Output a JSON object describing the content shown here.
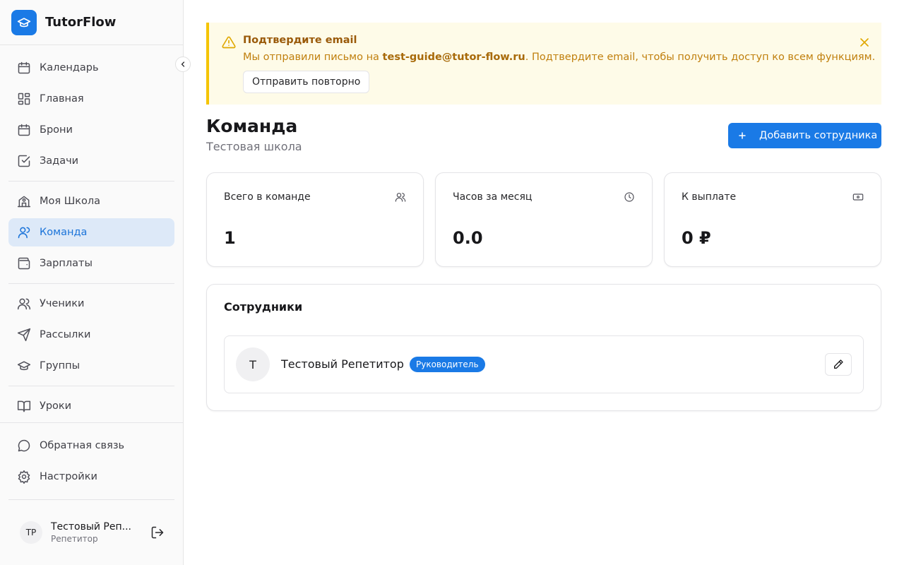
{
  "app": {
    "name": "TutorFlow",
    "logo_icon": "graduation-cap-icon",
    "accent": "#1a7ae6"
  },
  "sidebar": {
    "items": [
      {
        "label": "Календарь",
        "icon": "calendar-icon"
      },
      {
        "label": "Главная",
        "icon": "dashboard-icon"
      },
      {
        "label": "Брони",
        "icon": "calendar-icon"
      },
      {
        "label": "Задачи",
        "icon": "checkbox-icon"
      },
      {
        "label": "Моя Школа",
        "icon": "school-icon"
      },
      {
        "label": "Команда",
        "icon": "user-icon",
        "active": true
      },
      {
        "label": "Зарплаты",
        "icon": "wallet-icon"
      },
      {
        "label": "Ученики",
        "icon": "users-icon"
      },
      {
        "label": "Рассылки",
        "icon": "send-icon"
      },
      {
        "label": "Группы",
        "icon": "graduation-cap-icon"
      },
      {
        "label": "Уроки",
        "icon": "book-icon"
      },
      {
        "label": "Обратная связь",
        "icon": "message-icon"
      },
      {
        "label": "Настройки",
        "icon": "gear-icon"
      }
    ],
    "user": {
      "initials": "ТР",
      "name": "Тестовый Реп...",
      "role": "Репетитор"
    }
  },
  "alert": {
    "title": "Подтвердите email",
    "text_before": "Мы отправили письмо на ",
    "email": "test-guide@tutor-flow.ru",
    "text_after": ". Подтвердите email, чтобы получить доступ ко всем функциям.",
    "button": "Отправить повторно",
    "bg": "#fefbe8",
    "border": "#f5c400"
  },
  "header": {
    "title": "Команда",
    "subtitle": "Тестовая школа",
    "add_button": "Добавить сотрудника"
  },
  "stats": [
    {
      "label": "Всего в команде",
      "value": "1",
      "icon": "users-icon"
    },
    {
      "label": "Часов за месяц",
      "value": "0.0",
      "icon": "clock-icon"
    },
    {
      "label": "К выплате",
      "value": "0 ₽",
      "icon": "banknote-icon"
    }
  ],
  "staff": {
    "title": "Сотрудники",
    "members": [
      {
        "initial": "Т",
        "name": "Тестовый Репетитор",
        "badge": "Руководитель"
      }
    ]
  }
}
